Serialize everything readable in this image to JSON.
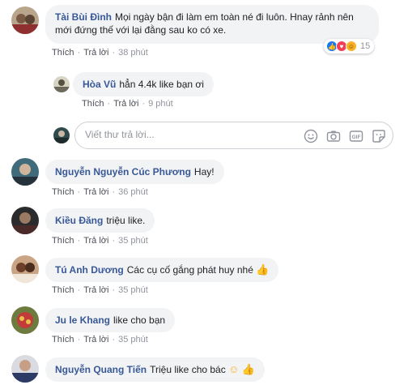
{
  "comments": [
    {
      "author": "Tài Bùi Đình",
      "text": "Mọi ngày bận đi làm em toàn né đi luôn. Hnay rảnh nên mới đứng thế với lại đằng sau ko có xe.",
      "like": "Thích",
      "reply": "Trả lời",
      "time": "38 phút",
      "reaction_count": "15",
      "reaction_icons": [
        "like-icon",
        "love-icon",
        "haha-icon"
      ],
      "replies": [
        {
          "author": "Hòa Vũ",
          "text": "hẳn 4.4k like bạn ơi",
          "like": "Thích",
          "reply": "Trả lời",
          "time": "9 phút"
        }
      ]
    },
    {
      "author": "Nguyễn Nguyễn Cúc Phương",
      "text": "Hay!",
      "like": "Thích",
      "reply": "Trả lời",
      "time": "36 phút"
    },
    {
      "author": "Kiều Đăng",
      "text": "triệu like.",
      "like": "Thích",
      "reply": "Trả lời",
      "time": "35 phút"
    },
    {
      "author": "Tú Anh Dương",
      "text": "Các cụ cố gắng phát huy nhé",
      "emoji": "thumbs-up-icon",
      "like": "Thích",
      "reply": "Trả lời",
      "time": "35 phút"
    },
    {
      "author": "Ju le Khang",
      "text": "like cho bạn",
      "like": "Thích",
      "reply": "Trả lời",
      "time": "35 phút"
    },
    {
      "author": "Nguyễn Quang Tiến",
      "text": "Triệu like cho bác",
      "emoji": "smile-icon thumbs-up-icon"
    }
  ],
  "reply_box": {
    "placeholder": "Viết thư trả lời...",
    "icons": [
      "emoji-icon",
      "camera-icon",
      "gif-icon",
      "sticker-icon"
    ]
  },
  "colors": {
    "author": "#385898",
    "bubble": "#f2f3f5",
    "meta": "#90949c",
    "like_blue": "#1877f2",
    "love_red": "#f33e58",
    "haha_yellow": "#f7b125"
  }
}
